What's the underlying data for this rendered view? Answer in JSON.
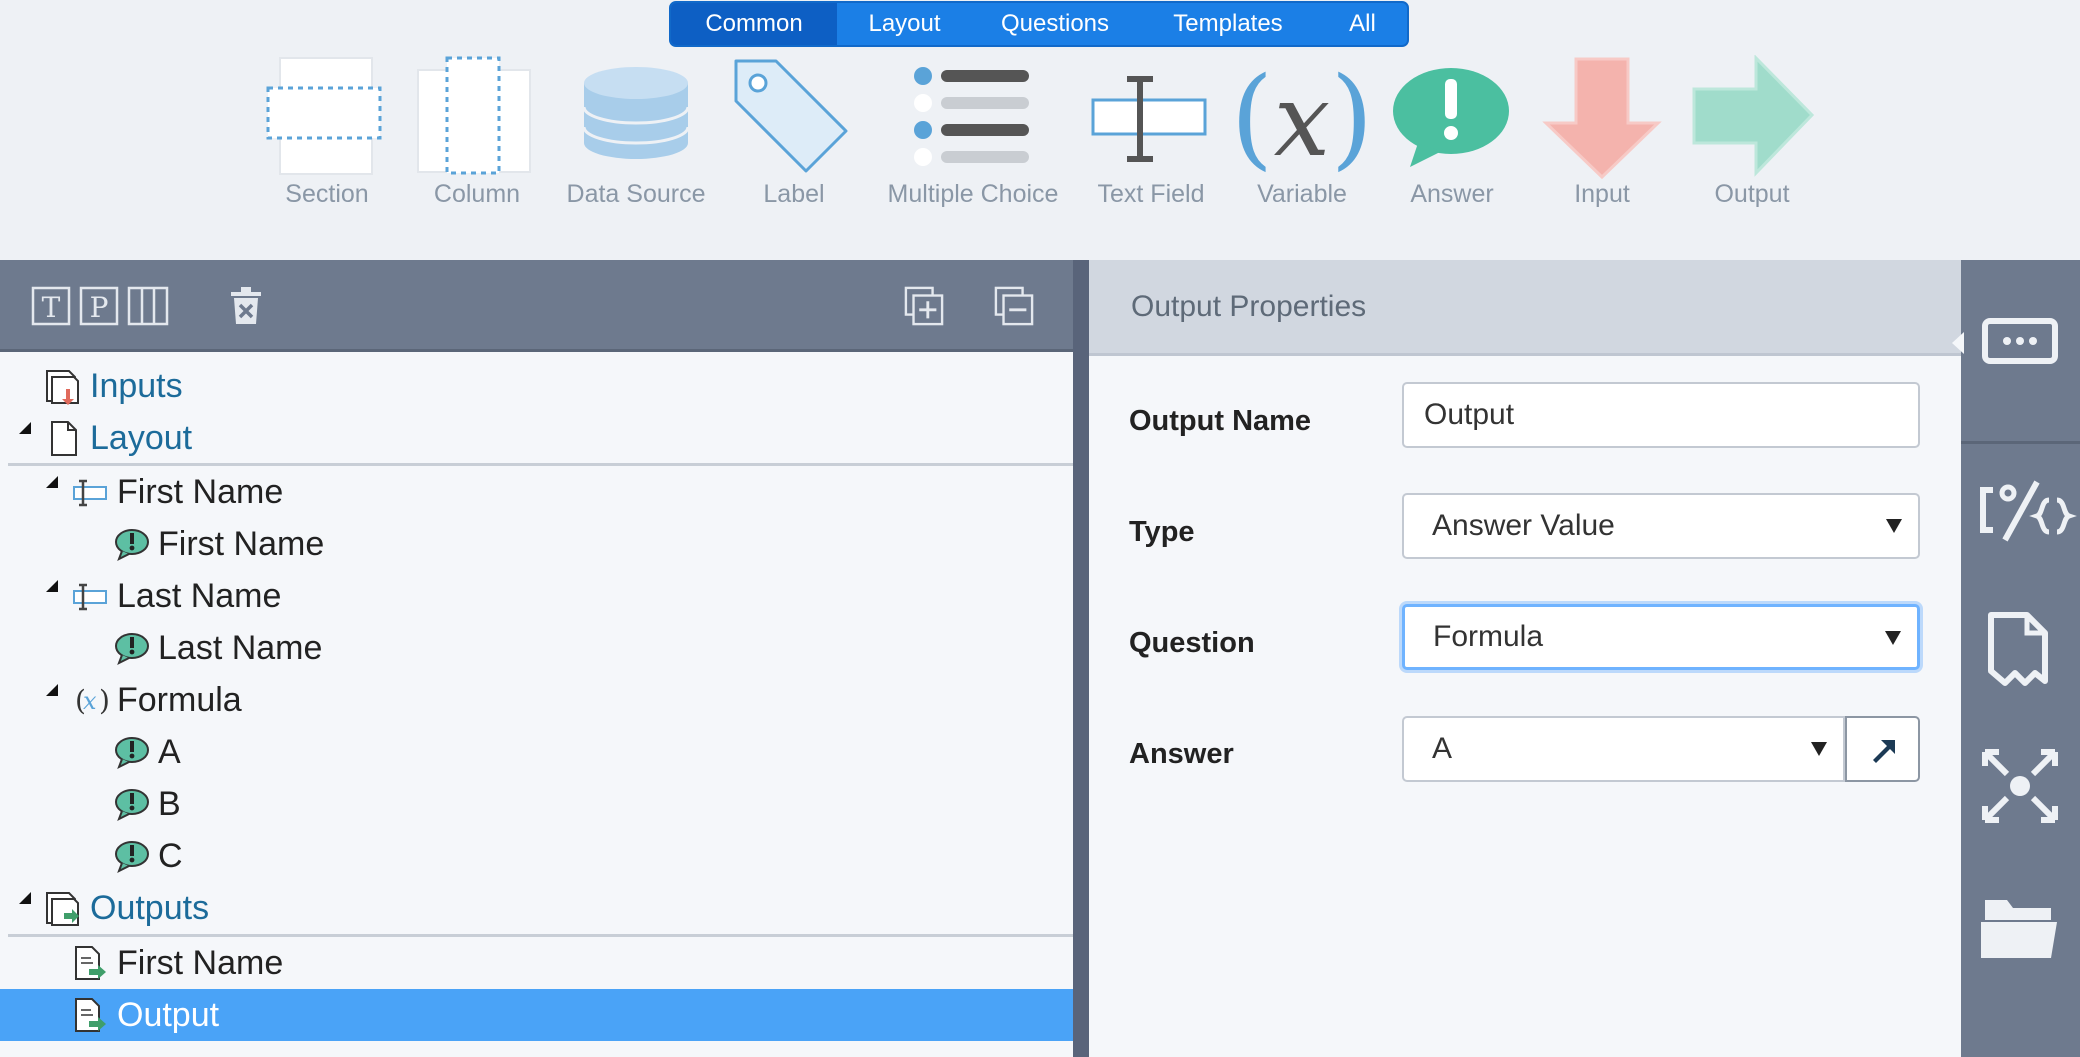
{
  "toolbox": {
    "tabs": [
      {
        "label": "Common"
      },
      {
        "label": "Layout"
      },
      {
        "label": "Questions"
      },
      {
        "label": "Templates"
      },
      {
        "label": "All"
      }
    ],
    "tools": [
      {
        "label": "Section",
        "icon": "section-icon"
      },
      {
        "label": "Column",
        "icon": "column-icon"
      },
      {
        "label": "Data Source",
        "icon": "database-icon"
      },
      {
        "label": "Label",
        "icon": "tag-icon"
      },
      {
        "label": "Multiple Choice",
        "icon": "list-icon"
      },
      {
        "label": "Text Field",
        "icon": "text-field-icon"
      },
      {
        "label": "Variable",
        "icon": "variable-icon"
      },
      {
        "label": "Answer",
        "icon": "speech-bubble-icon"
      },
      {
        "label": "Input",
        "icon": "arrow-down-icon"
      },
      {
        "label": "Output",
        "icon": "arrow-right-icon"
      }
    ]
  },
  "tree": {
    "toolbar": {
      "t_glyph": "T",
      "p_glyph": "P"
    },
    "nodes": [
      {
        "label": "Inputs"
      },
      {
        "label": "Layout"
      },
      {
        "label": "First Name"
      },
      {
        "label": "First Name"
      },
      {
        "label": "Last Name"
      },
      {
        "label": "Last Name"
      },
      {
        "label": "Formula"
      },
      {
        "label": "A"
      },
      {
        "label": "B"
      },
      {
        "label": "C"
      },
      {
        "label": "Outputs"
      },
      {
        "label": "First Name"
      },
      {
        "label": "Output"
      }
    ]
  },
  "properties": {
    "title": "Output Properties",
    "output_name": {
      "label": "Output Name",
      "value": "Output"
    },
    "type": {
      "label": "Type",
      "value": "Answer Value"
    },
    "question": {
      "label": "Question",
      "value": "Formula"
    },
    "answer": {
      "label": "Answer",
      "value": "A"
    }
  },
  "colors": {
    "accent": "#1b7fe6",
    "selection": "#4aa3f7",
    "panel": "#6e7a8e"
  }
}
